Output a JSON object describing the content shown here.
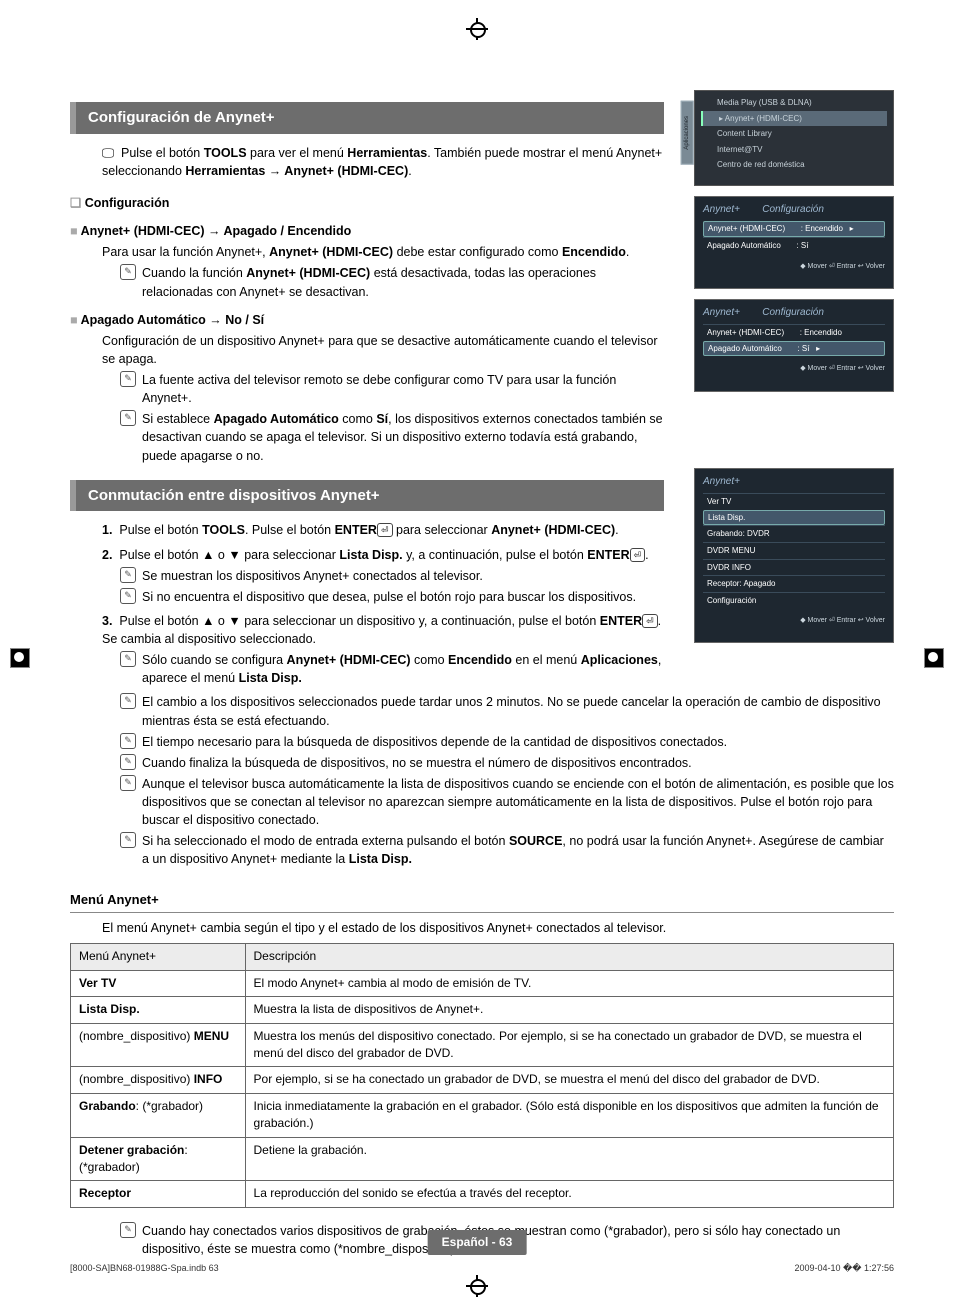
{
  "h1": "Configuración de Anynet+",
  "intro_a": "Pulse el botón ",
  "intro_tools": "TOOLS",
  "intro_b": " para ver el menú ",
  "intro_herr": "Herramientas",
  "intro_c": ". También puede mostrar el menú Anynet+ seleccionando ",
  "intro_path": "Herramientas → Anynet+ (HDMI-CEC)",
  "intro_d": ".",
  "cfg_head": "Configuración",
  "sec1_title": "Anynet+ (HDMI-CEC) → Apagado / Encendido",
  "sec1_p": "Para usar la función Anynet+, ",
  "sec1_bold": "Anynet+ (HDMI-CEC)",
  "sec1_p2": " debe estar configurado como ",
  "sec1_enc": "Encendido",
  "sec1_p3": ".",
  "sec1_note_a": "Cuando la función ",
  "sec1_note_bold": "Anynet+ (HDMI-CEC)",
  "sec1_note_b": " está desactivada, todas las operaciones relacionadas con Anynet+ se desactivan.",
  "sec2_title": "Apagado Automático → No / Sí",
  "sec2_p": "Configuración de un dispositivo Anynet+ para que se desactive automáticamente cuando el televisor se apaga.",
  "sec2_note1": "La fuente activa del televisor remoto se debe configurar como TV para usar la función Anynet+.",
  "sec2_note2_a": "Si establece ",
  "sec2_note2_bold1": "Apagado Automático",
  "sec2_note2_b": " como ",
  "sec2_note2_bold2": "Sí",
  "sec2_note2_c": ", los dispositivos externos conectados también se desactivan cuando se apaga el televisor. Si un dispositivo externo todavía está grabando, puede apagarse o no.",
  "h2": "Conmutación entre dispositivos Anynet+",
  "step1_a": "Pulse el botón ",
  "step1_tools": "TOOLS",
  "step1_b": ". Pulse el botón ",
  "step1_enter": "ENTER",
  "step1_c": " para seleccionar ",
  "step1_bold": "Anynet+ (HDMI-CEC)",
  "step1_d": ".",
  "step2_a": "Pulse el botón ▲ o ▼ para seleccionar ",
  "step2_bold": "Lista Disp.",
  "step2_b": " y, a continuación, pulse el botón ",
  "step2_c": ".",
  "step2_n1": "Se muestran los dispositivos Anynet+ conectados al televisor.",
  "step2_n2": "Si no encuentra el dispositivo que desea, pulse el botón rojo para buscar los dispositivos.",
  "step3_a": "Pulse el botón ▲ o ▼ para seleccionar un dispositivo y, a continuación, pulse el botón ",
  "step3_b": ". Se cambia al dispositivo seleccionado.",
  "step3_n1_a": "Sólo cuando se configura ",
  "step3_n1_bold1": "Anynet+ (HDMI-CEC)",
  "step3_n1_b": " como ",
  "step3_n1_bold2": "Encendido",
  "step3_n1_c": " en el menú ",
  "step3_n1_bold3": "Aplicaciones",
  "step3_n1_d": ", aparece el menú ",
  "step3_n1_bold4": "Lista Disp.",
  "gnote1": "El cambio a los dispositivos seleccionados puede tardar unos 2 minutos. No se puede cancelar la operación de cambio de dispositivo mientras ésta se está efectuando.",
  "gnote2": "El tiempo necesario para la búsqueda de dispositivos depende de la cantidad de dispositivos conectados.",
  "gnote3": "Cuando finaliza la búsqueda de dispositivos, no se muestra el número de dispositivos encontrados.",
  "gnote4": "Aunque el televisor busca automáticamente la lista de dispositivos cuando se enciende con el botón de alimentación, es posible que los dispositivos que se conectan al televisor no aparezcan siempre automáticamente en la lista de dispositivos. Pulse el botón rojo para buscar el dispositivo conectado.",
  "gnote5_a": "Si ha seleccionado el modo de entrada externa pulsando el botón ",
  "gnote5_src": "SOURCE",
  "gnote5_b": ", no podrá usar la función Anynet+. Asegúrese de cambiar a un dispositivo Anynet+ mediante la ",
  "gnote5_bold": "Lista Disp.",
  "menu_head": "Menú Anynet+",
  "menu_sub": "El menú Anynet+ cambia según el tipo y el estado de los dispositivos Anynet+ conectados al televisor.",
  "th1": "Menú Anynet+",
  "th2": "Descripción",
  "rows": [
    {
      "a": "Ver TV",
      "b": "El modo Anynet+ cambia al modo de emisión de TV."
    },
    {
      "a": "Lista Disp.",
      "b": "Muestra la lista de dispositivos de Anynet+."
    },
    {
      "a": "(nombre_dispositivo) MENU",
      "b": "Muestra los menús del dispositivo conectado. Por ejemplo, si se ha conectado un grabador de DVD, se muestra el menú del disco del grabador de DVD."
    },
    {
      "a": "(nombre_dispositivo) INFO",
      "b": "Por ejemplo, si se ha conectado un grabador de DVD, se muestra el menú del disco del grabador de DVD."
    },
    {
      "a": "Grabando: (*grabador)",
      "b": "Inicia inmediatamente la grabación en el grabador. (Sólo está disponible en los dispositivos que admiten la función de grabación.)"
    },
    {
      "a": "Detener grabación: (*grabador)",
      "b": "Detiene la grabación."
    },
    {
      "a": "Receptor",
      "b": "La reproducción del sonido se efectúa a través del receptor."
    }
  ],
  "lastnote": "Cuando hay conectados varios dispositivos de grabación, éstos se muestran como (*grabador), pero si sólo hay conectado un dispositivo, éste se muestra como (*nombre_dispositivo).",
  "app": {
    "tab": "Aplicaciones",
    "i1": "Media Play (USB & DLNA)",
    "i2": "Anynet+ (HDMI-CEC)",
    "i3": "Content Library",
    "i4": "Internet@TV",
    "i5": "Centro de red doméstica"
  },
  "cfgbox": {
    "brand": "Anynet+",
    "title": "Configuración",
    "r1a": "Anynet+ (HDMI-CEC)",
    "r1b": ": Encendido",
    "r2a": "Apagado Automático",
    "r2b": ": Sí",
    "foot": "◆ Mover   ⏎ Entrar   ↩ Volver"
  },
  "listbox": {
    "brand": "Anynet+",
    "r1": "Ver TV",
    "r2": "Lista Disp.",
    "r3": "Grabando: DVDR",
    "r4": "DVDR MENU",
    "r5": "DVDR INFO",
    "r6": "Receptor: Apagado",
    "r7": "Configuración",
    "foot": "◆ Mover   ⏎ Entrar   ↩ Volver"
  },
  "pgnum": "Español - 63",
  "footL": "[8000-SA]BN68-01988G-Spa.indb   63",
  "footR": "2009-04-10   �� 1:27:56"
}
